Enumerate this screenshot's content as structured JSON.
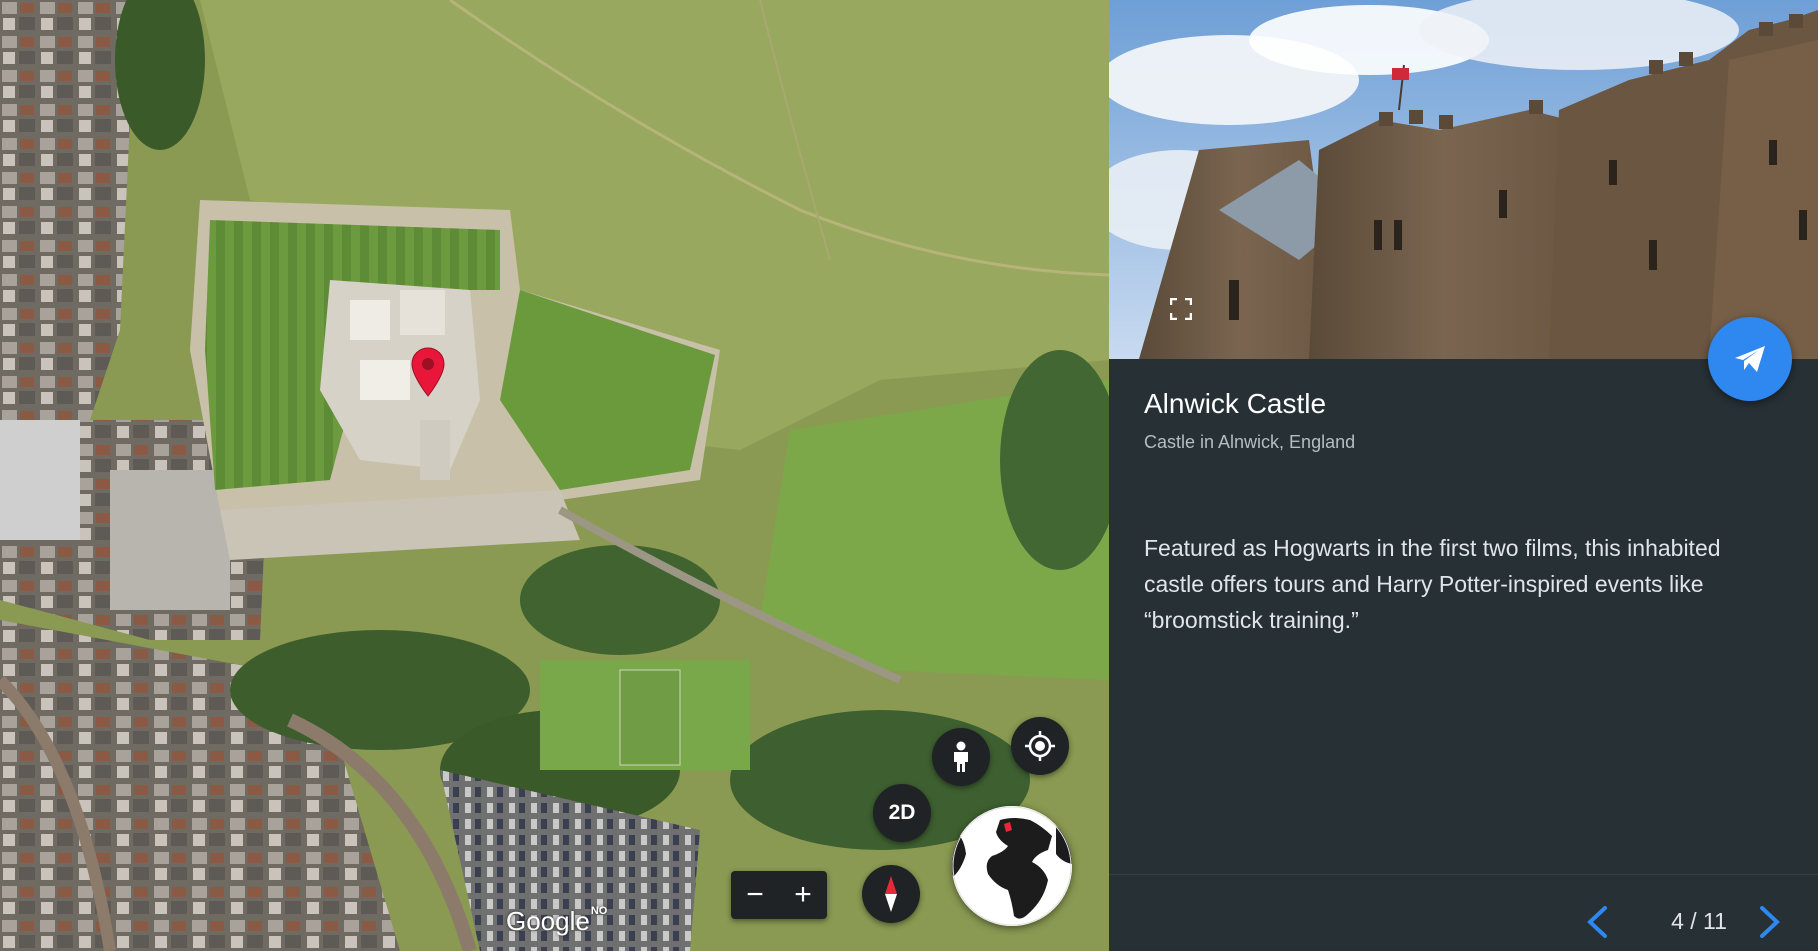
{
  "map": {
    "google_logo": "Google",
    "google_logo_suffix": "NO",
    "buttons": {
      "pegman_icon": "person-icon",
      "locate_icon": "my-location-icon",
      "view_mode_label": "2D",
      "compass_icon": "compass-icon",
      "zoom_out_label": "−",
      "zoom_in_label": "+"
    },
    "pin_color": "#e8173a"
  },
  "panel": {
    "title": "Alnwick Castle",
    "subtitle": "Castle in Alnwick, England",
    "description": "Featured as Hogwarts in the first two films, this inhabited castle offers tours and Harry Potter-inspired events like “broomstick training.”",
    "pager": "4 / 11",
    "share_icon": "paper-plane-icon",
    "fullscreen_icon": "fullscreen-icon",
    "accent_color": "#2f87f0",
    "background_color": "#263035"
  }
}
